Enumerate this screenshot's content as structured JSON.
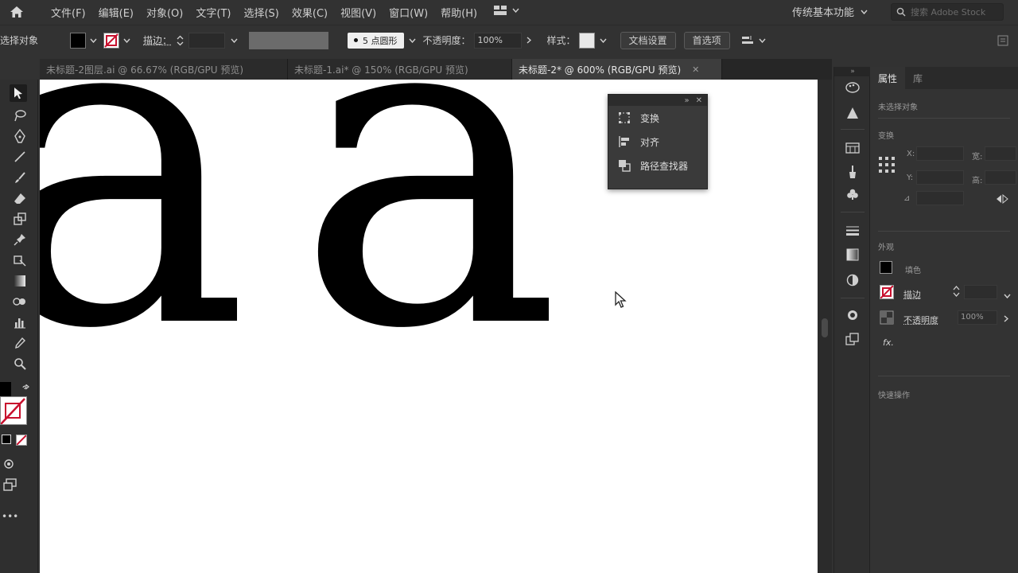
{
  "menu": {
    "items": [
      "文件(F)",
      "编辑(E)",
      "对象(O)",
      "文字(T)",
      "选择(S)",
      "效果(C)",
      "视图(V)",
      "窗口(W)",
      "帮助(H)"
    ],
    "workspace": "传统基本功能",
    "search_placeholder": "搜索 Adobe Stock"
  },
  "control": {
    "no_selection": "选择对象",
    "stroke_label": "描边：",
    "brush": "5 点圆形",
    "opacity_label": "不透明度：",
    "opacity_value": "100%",
    "style_label": "样式：",
    "doc_setup": "文档设置",
    "preferences": "首选项"
  },
  "tabs": [
    {
      "label": "未标题-2图层.ai @ 66.67% (RGB/GPU 预览)",
      "active": false
    },
    {
      "label": "未标题-1.ai* @ 150% (RGB/GPU 预览)",
      "active": false
    },
    {
      "label": "未标题-2* @ 600% (RGB/GPU 预览)",
      "active": true
    }
  ],
  "canvas": {
    "glyph_left": "a",
    "glyph_right": "a"
  },
  "float_panel": {
    "items": [
      "变换",
      "对齐",
      "路径查找器"
    ]
  },
  "properties": {
    "tab_properties": "属性",
    "tab_layers": "库",
    "no_selection": "未选择对象",
    "transform_heading": "变换",
    "x_label": "X:",
    "y_label": "Y:",
    "w_label": "宽:",
    "h_label": "高:",
    "angle_label": "⊿",
    "appearance_heading": "外观",
    "fill_label": "填色",
    "stroke_label": "描边",
    "opacity_label": "不透明度",
    "opacity_value": "100%",
    "fx_label": "fx.",
    "quick_actions_heading": "快速操作"
  },
  "colors": {
    "accent_stroke": "#c8102e",
    "bg_dark": "#323232"
  }
}
